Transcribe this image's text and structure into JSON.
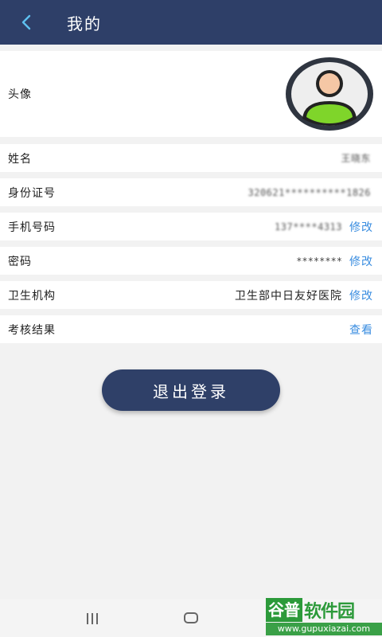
{
  "header": {
    "title": "我的",
    "back_icon": "chevron-left-icon"
  },
  "rows": {
    "avatar": {
      "label": "头像"
    },
    "name": {
      "label": "姓名",
      "value": "王晓东"
    },
    "id_card": {
      "label": "身份证号",
      "value": "320621**********1826"
    },
    "phone": {
      "label": "手机号码",
      "value": "137****4313",
      "action": "修改"
    },
    "password": {
      "label": "密码",
      "value": "********",
      "action": "修改"
    },
    "institution": {
      "label": "卫生机构",
      "value": "卫生部中日友好医院",
      "action": "修改"
    },
    "exam": {
      "label": "考核结果",
      "action": "查看"
    }
  },
  "logout": {
    "label": "退出登录"
  },
  "watermark": {
    "badge": "谷普",
    "text": "软件园",
    "url": "www.gupuxiazai.com"
  },
  "colors": {
    "header": "#2e3f68",
    "link": "#3a8de0",
    "button": "#2f4068"
  }
}
